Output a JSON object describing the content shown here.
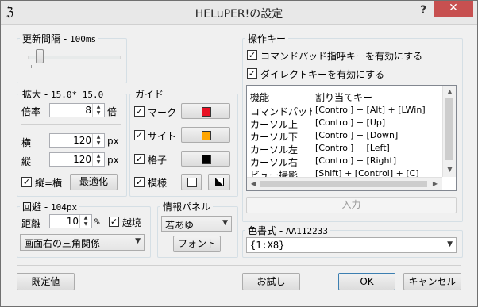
{
  "window": {
    "title": "HELuPER!の設定",
    "help": "?",
    "close": "✕"
  },
  "update": {
    "label": "更新間隔 -",
    "value": "100ms",
    "slider_fraction": 0.13
  },
  "zoom": {
    "label": "拡大 -",
    "value": "15.0* 15.0",
    "scale_label": "倍率",
    "scale_value": "8",
    "scale_unit": "倍",
    "width_label": "横",
    "width_value": "120",
    "width_unit": "px",
    "height_label": "縦",
    "height_value": "120",
    "height_unit": "px",
    "lock_label": "縦=横",
    "lock_checked": true,
    "optimize_label": "最適化"
  },
  "guide": {
    "label": "ガイド",
    "items": [
      {
        "label": "マーク",
        "checked": true,
        "color": "#e81123"
      },
      {
        "label": "サイト",
        "checked": true,
        "color": "#ffa500"
      },
      {
        "label": "格子",
        "checked": true,
        "color": "#000000"
      },
      {
        "label": "模様",
        "checked": true
      }
    ]
  },
  "evade": {
    "label": "回避 -",
    "value": "104px",
    "distance_label": "距離",
    "distance_value": "10",
    "distance_unit": "%",
    "cross_label": "越境",
    "cross_checked": true,
    "mode_value": "画面右の三角関係"
  },
  "info_panel": {
    "label": "情報パネル",
    "font_value": "若あゆ",
    "font_button": "フォント"
  },
  "keys": {
    "label": "操作キー",
    "command_pad": "コマンドパッド指呼キーを有効にする",
    "command_pad_checked": true,
    "direct_key": "ダイレクトキーを有効にする",
    "direct_key_checked": true,
    "columns": [
      "機能",
      "割り当てキー"
    ],
    "rows": [
      {
        "func": "コマンドパッド...",
        "key": "[Control] + [Alt] + [LWin]"
      },
      {
        "func": "カーソル上",
        "key": "[Control] + [Up]"
      },
      {
        "func": "カーソル下",
        "key": "[Control] + [Down]"
      },
      {
        "func": "カーソル左",
        "key": "[Control] + [Left]"
      },
      {
        "func": "カーソル右",
        "key": "[Control] + [Right]"
      },
      {
        "func": "ビュー撮影",
        "key": "[Shift] + [Control] + [C]"
      }
    ],
    "input_button": "入力"
  },
  "color_format": {
    "label": "色書式 -",
    "value": "AA112233",
    "format_value": "{1:X8}"
  },
  "footer": {
    "default": "既定値",
    "try": "お試し",
    "ok": "OK",
    "cancel": "キャンセル"
  }
}
